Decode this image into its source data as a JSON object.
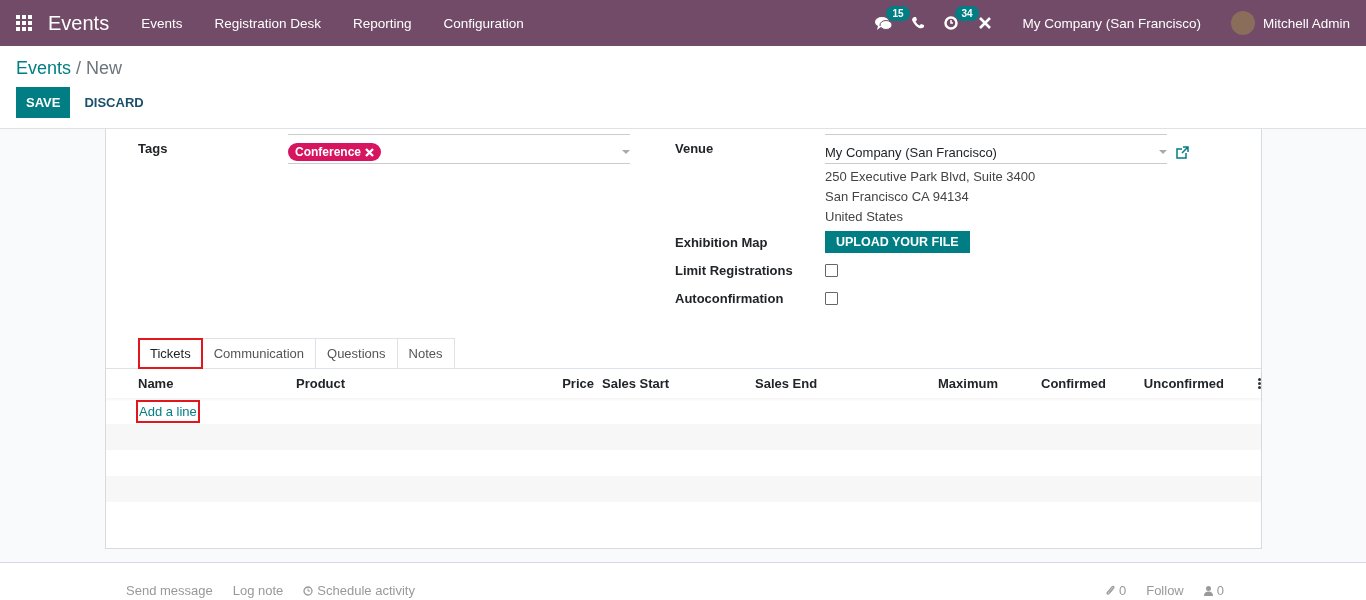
{
  "navbar": {
    "app_name": "Events",
    "menu": [
      "Events",
      "Registration Desk",
      "Reporting",
      "Configuration"
    ],
    "messages_count": "15",
    "activities_count": "34",
    "company": "My Company (San Francisco)",
    "user": "Mitchell Admin"
  },
  "breadcrumb": {
    "parent": "Events",
    "separator": "/",
    "current": "New"
  },
  "buttons": {
    "save": "SAVE",
    "discard": "DISCARD"
  },
  "form": {
    "tags_label": "Tags",
    "tags": [
      {
        "label": "Conference",
        "color": "#d6145f"
      }
    ],
    "venue_label": "Venue",
    "venue": "My Company (San Francisco)",
    "address": [
      "250 Executive Park Blvd, Suite 3400",
      "San Francisco CA 94134",
      "United States"
    ],
    "exhibition_map_label": "Exhibition Map",
    "upload_button": "UPLOAD YOUR FILE",
    "checkboxes": [
      {
        "label": "Limit Registrations",
        "checked": false
      },
      {
        "label": "Autoconfirmation",
        "checked": false
      }
    ]
  },
  "tabs": [
    {
      "label": "Tickets",
      "selected": true,
      "highlighted": true
    },
    {
      "label": "Communication",
      "selected": false,
      "highlighted": false
    },
    {
      "label": "Questions",
      "selected": false,
      "highlighted": false
    },
    {
      "label": "Notes",
      "selected": false,
      "highlighted": false
    }
  ],
  "table": {
    "columns": [
      "Name",
      "Product",
      "Price",
      "Sales Start",
      "Sales End",
      "Maximum",
      "Confirmed",
      "Unconfirmed"
    ],
    "add_line": {
      "label": "Add a line",
      "highlighted": true
    }
  },
  "chatter": {
    "send_message": "Send message",
    "log_note": "Log note",
    "schedule_activity": "Schedule activity",
    "attachments_count": "0",
    "follow": "Follow",
    "followers_count": "0"
  }
}
